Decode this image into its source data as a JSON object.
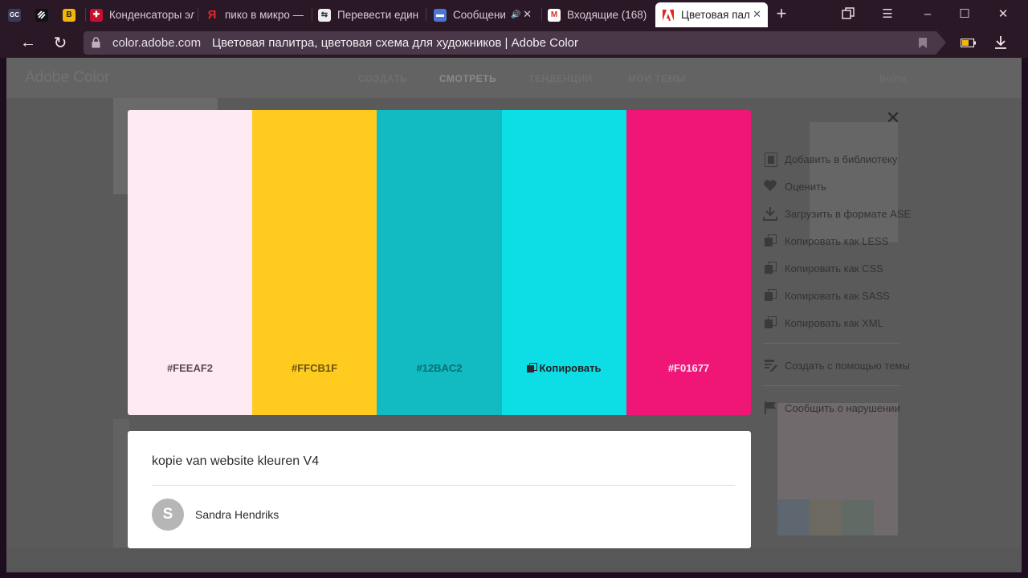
{
  "browser": {
    "tabs": [
      {
        "label": "",
        "icon": "gc-favicon"
      },
      {
        "label": "",
        "icon": "link-favicon"
      },
      {
        "label": "",
        "icon": "vk-favicon"
      },
      {
        "label": "Конденсаторы эл",
        "icon": "site-favicon"
      },
      {
        "label": "пико в микро —",
        "icon": "yandex-favicon"
      },
      {
        "label": "Перевести един",
        "icon": "translate-favicon"
      },
      {
        "label": "Сообщени",
        "icon": "messages-favicon"
      },
      {
        "label": "Входящие (168)",
        "icon": "gmail-favicon"
      },
      {
        "label": "Цветовая пал",
        "icon": "adobe-favicon"
      }
    ],
    "address": {
      "domain": "color.adobe.com",
      "title": "Цветовая палитра, цветовая схема для художников | Adobe Color"
    }
  },
  "site": {
    "brand": "Adobe Color",
    "nav": [
      "СОЗДАТЬ",
      "СМОТРЕТЬ",
      "ТЕНДЕНЦИИ",
      "МОИ ТЕМЫ"
    ],
    "login": "Войти"
  },
  "palette": {
    "swatches": [
      {
        "hex": "#FEEAF2",
        "label": "#FEEAF2",
        "text_color": "#5a4a50"
      },
      {
        "hex": "#FFCB1F",
        "label": "#FFCB1F",
        "text_color": "#6a5210"
      },
      {
        "hex": "#12BAC2",
        "label": "#12BAC2",
        "text_color": "#0b6d72"
      },
      {
        "hex": "#0DDEE6",
        "label": "Копировать",
        "text_color": "#222222"
      },
      {
        "hex": "#F01677",
        "label": "#F01677",
        "text_color": "#fde6f0"
      }
    ]
  },
  "theme": {
    "name": "kopie van website kleuren V4",
    "author": "Sandra Hendriks",
    "avatar_initial": "S"
  },
  "actions": {
    "add_to_library": "Добавить в библиотеку",
    "rate": "Оценить",
    "download_ase": "Загрузить в формате ASE",
    "copy_less": "Копировать как LESS",
    "copy_css": "Копировать как CSS",
    "copy_sass": "Копировать как SASS",
    "copy_xml": "Копировать как XML",
    "create_with_theme": "Создать с помощью темы",
    "report": "Сообщить о нарушении"
  }
}
